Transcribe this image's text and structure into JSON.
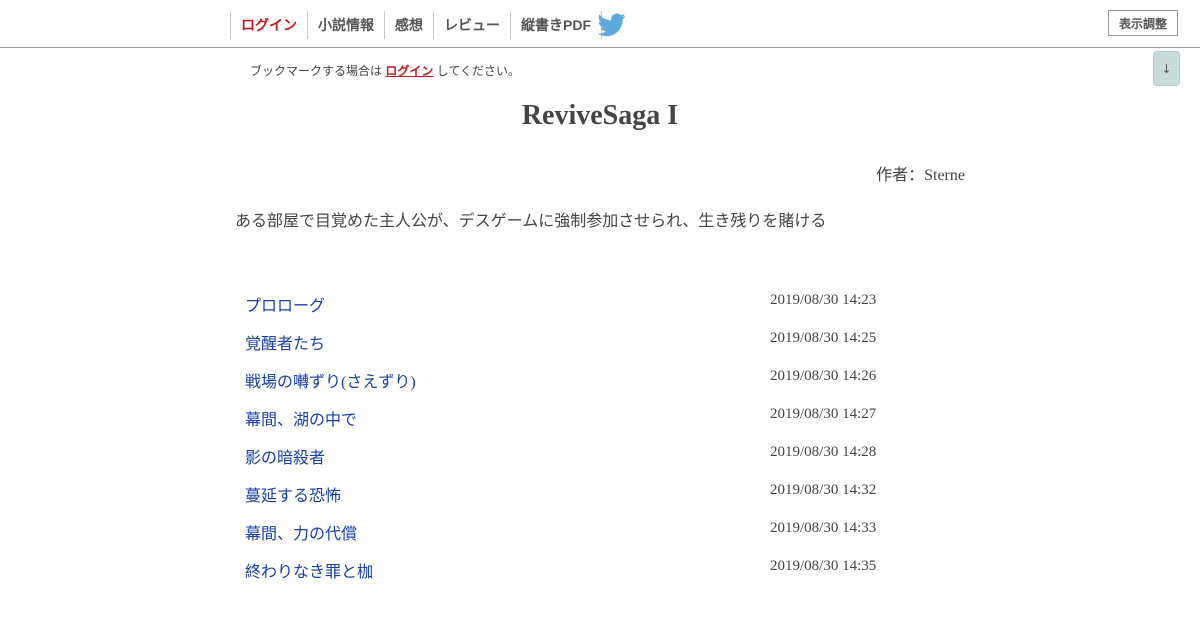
{
  "header": {
    "nav": [
      {
        "label": "ログイン",
        "name": "nav-login"
      },
      {
        "label": "小説情報",
        "name": "nav-novel-info"
      },
      {
        "label": "感想",
        "name": "nav-impressions"
      },
      {
        "label": "レビュー",
        "name": "nav-review"
      },
      {
        "label": "縦書きPDF",
        "name": "nav-vertical-pdf"
      }
    ],
    "twitter_icon": "twitter-bird-icon",
    "display_settings_label": "表示調整"
  },
  "scroll_down": {
    "label": "↓",
    "icon": "arrow-down-icon"
  },
  "bookmark_note": {
    "prefix": "ブックマークする場合は",
    "link": "ログイン",
    "suffix": "してください。"
  },
  "novel": {
    "title": "ReviveSaga I",
    "author": "作者：Sterne",
    "synopsis": "ある部屋で目覚めた主人公が、デスゲームに強制参加させられ、生き残りを賭ける"
  },
  "chapters": [
    {
      "title": "プロローグ",
      "date": "2019/08/30 14:23"
    },
    {
      "title": "覚醒者たち",
      "date": "2019/08/30 14:25"
    },
    {
      "title": "戦場の囀ずり(さえずり)",
      "date": "2019/08/30 14:26"
    },
    {
      "title": "幕間、湖の中で",
      "date": "2019/08/30 14:27"
    },
    {
      "title": "影の暗殺者",
      "date": "2019/08/30 14:28"
    },
    {
      "title": "蔓延する恐怖",
      "date": "2019/08/30 14:32"
    },
    {
      "title": "幕間、力の代償",
      "date": "2019/08/30 14:33"
    },
    {
      "title": "終わりなき罪と枷",
      "date": "2019/08/30 14:35"
    }
  ],
  "colors": {
    "login_red": "#c4161c",
    "link_blue": "#1a3fa8",
    "twitter_blue": "#5ea9dd",
    "scroll_button": "#c9dcdc"
  }
}
